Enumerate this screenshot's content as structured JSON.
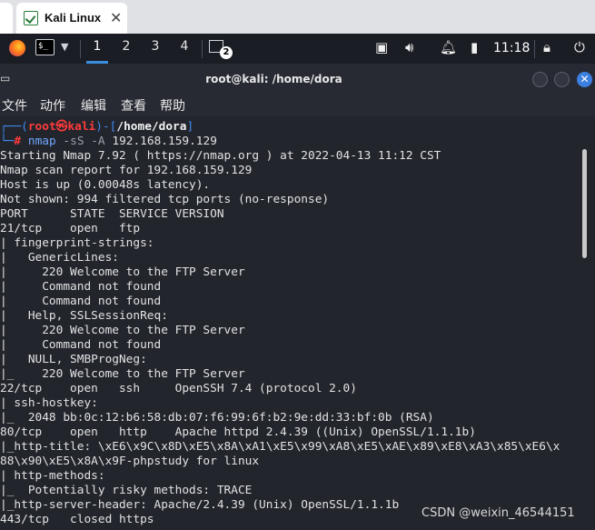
{
  "browser_tab": {
    "title": "Kali Linux",
    "close_glyph": "✕"
  },
  "panel": {
    "workspaces": [
      "1",
      "2",
      "3",
      "4"
    ],
    "active_workspace": "1",
    "task_count": "2",
    "clock": "11:18"
  },
  "terminal": {
    "title": "root@kali: /home/dora",
    "menu": [
      "文件",
      "动作",
      "编辑",
      "查看",
      "帮助"
    ]
  },
  "prompt": {
    "corner": "┌──(",
    "user_host": "root㉿kali",
    "sep": ")-[",
    "path": "/home/dora",
    "close": "]",
    "line2_prefix": "└─",
    "hash": "#",
    "command": "nmap",
    "args": "-sS -A",
    "target": "192.168.159.129"
  },
  "output": [
    "Starting Nmap 7.92 ( https://nmap.org ) at 2022-04-13 11:12 CST",
    "Nmap scan report for 192.168.159.129",
    "Host is up (0.00048s latency).",
    "Not shown: 994 filtered tcp ports (no-response)",
    "PORT      STATE  SERVICE VERSION",
    "21/tcp    open   ftp",
    "| fingerprint-strings:",
    "|   GenericLines:",
    "|     220 Welcome to the FTP Server",
    "|     Command not found",
    "|     Command not found",
    "|   Help, SSLSessionReq:",
    "|     220 Welcome to the FTP Server",
    "|     Command not found",
    "|   NULL, SMBProgNeg:",
    "|_    220 Welcome to the FTP Server",
    "22/tcp    open   ssh     OpenSSH 7.4 (protocol 2.0)",
    "| ssh-hostkey:",
    "|_  2048 bb:0c:12:b6:58:db:07:f6:99:6f:b2:9e:dd:33:bf:0b (RSA)",
    "80/tcp    open   http    Apache httpd 2.4.39 ((Unix) OpenSSL/1.1.1b)",
    "|_http-title: \\xE6\\x9C\\x8D\\xE5\\x8A\\xA1\\xE5\\x99\\xA8\\xE5\\xAE\\x89\\xE8\\xA3\\x85\\xE6\\x",
    "88\\x90\\xE5\\x8A\\x9F-phpstudy for linux",
    "| http-methods:",
    "|_  Potentially risky methods: TRACE",
    "|_http-server-header: Apache/2.4.39 (Unix) OpenSSL/1.1.1b",
    "443/tcp   closed https"
  ],
  "watermark": "CSDN @weixin_46544151",
  "colors": {
    "prompt_blue": "#3f8cf0",
    "prompt_red": "#ff3b3b",
    "close_button": "#3b7fe0"
  },
  "icons": [
    "firefox-icon",
    "terminal-icon",
    "network-icon",
    "volume-icon",
    "bell-icon",
    "battery-icon",
    "lock-icon",
    "power-icon"
  ]
}
